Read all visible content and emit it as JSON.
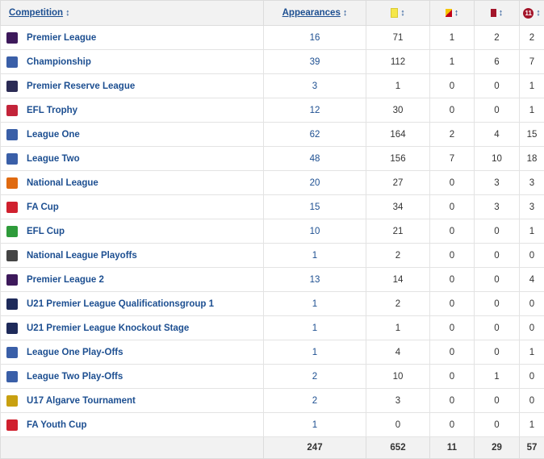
{
  "header": {
    "competition": "Competition",
    "appearances": "Appearances",
    "sort_glyph": "↕",
    "sub_icon_text": "11"
  },
  "rows": [
    {
      "competition": "Premier League",
      "appearances": "16",
      "yellow": "71",
      "yellow_red": "1",
      "red": "2",
      "subs": "2",
      "logo_color": "#3d195b"
    },
    {
      "competition": "Championship",
      "appearances": "39",
      "yellow": "112",
      "yellow_red": "1",
      "red": "6",
      "subs": "7",
      "logo_color": "#3a5fa8"
    },
    {
      "competition": "Premier Reserve League",
      "appearances": "3",
      "yellow": "1",
      "yellow_red": "0",
      "red": "0",
      "subs": "1",
      "logo_color": "#2b2b55"
    },
    {
      "competition": "EFL Trophy",
      "appearances": "12",
      "yellow": "30",
      "yellow_red": "0",
      "red": "0",
      "subs": "1",
      "logo_color": "#c3243a"
    },
    {
      "competition": "League One",
      "appearances": "62",
      "yellow": "164",
      "yellow_red": "2",
      "red": "4",
      "subs": "15",
      "logo_color": "#3a5fa8"
    },
    {
      "competition": "League Two",
      "appearances": "48",
      "yellow": "156",
      "yellow_red": "7",
      "red": "10",
      "subs": "18",
      "logo_color": "#3a5fa8"
    },
    {
      "competition": "National League",
      "appearances": "20",
      "yellow": "27",
      "yellow_red": "0",
      "red": "3",
      "subs": "3",
      "logo_color": "#e06a10"
    },
    {
      "competition": "FA Cup",
      "appearances": "15",
      "yellow": "34",
      "yellow_red": "0",
      "red": "3",
      "subs": "3",
      "logo_color": "#d0202e"
    },
    {
      "competition": "EFL Cup",
      "appearances": "10",
      "yellow": "21",
      "yellow_red": "0",
      "red": "0",
      "subs": "1",
      "logo_color": "#2e9b3a"
    },
    {
      "competition": "National League Playoffs",
      "appearances": "1",
      "yellow": "2",
      "yellow_red": "0",
      "red": "0",
      "subs": "0",
      "logo_color": "#444444"
    },
    {
      "competition": "Premier League 2",
      "appearances": "13",
      "yellow": "14",
      "yellow_red": "0",
      "red": "0",
      "subs": "4",
      "logo_color": "#3d195b"
    },
    {
      "competition": "U21 Premier League Qualificationsgroup 1",
      "appearances": "1",
      "yellow": "2",
      "yellow_red": "0",
      "red": "0",
      "subs": "0",
      "logo_color": "#1e2a5a"
    },
    {
      "competition": "U21 Premier League Knockout Stage",
      "appearances": "1",
      "yellow": "1",
      "yellow_red": "0",
      "red": "0",
      "subs": "0",
      "logo_color": "#1e2a5a"
    },
    {
      "competition": "League One Play-Offs",
      "appearances": "1",
      "yellow": "4",
      "yellow_red": "0",
      "red": "0",
      "subs": "1",
      "logo_color": "#3a5fa8"
    },
    {
      "competition": "League Two Play-Offs",
      "appearances": "2",
      "yellow": "10",
      "yellow_red": "0",
      "red": "1",
      "subs": "0",
      "logo_color": "#3a5fa8"
    },
    {
      "competition": "U17 Algarve Tournament",
      "appearances": "2",
      "yellow": "3",
      "yellow_red": "0",
      "red": "0",
      "subs": "0",
      "logo_color": "#c8a010"
    },
    {
      "competition": "FA Youth Cup",
      "appearances": "1",
      "yellow": "0",
      "yellow_red": "0",
      "red": "0",
      "subs": "1",
      "logo_color": "#d0202e"
    }
  ],
  "totals": {
    "competition": "",
    "appearances": "247",
    "yellow": "652",
    "yellow_red": "11",
    "red": "29",
    "subs": "57"
  }
}
